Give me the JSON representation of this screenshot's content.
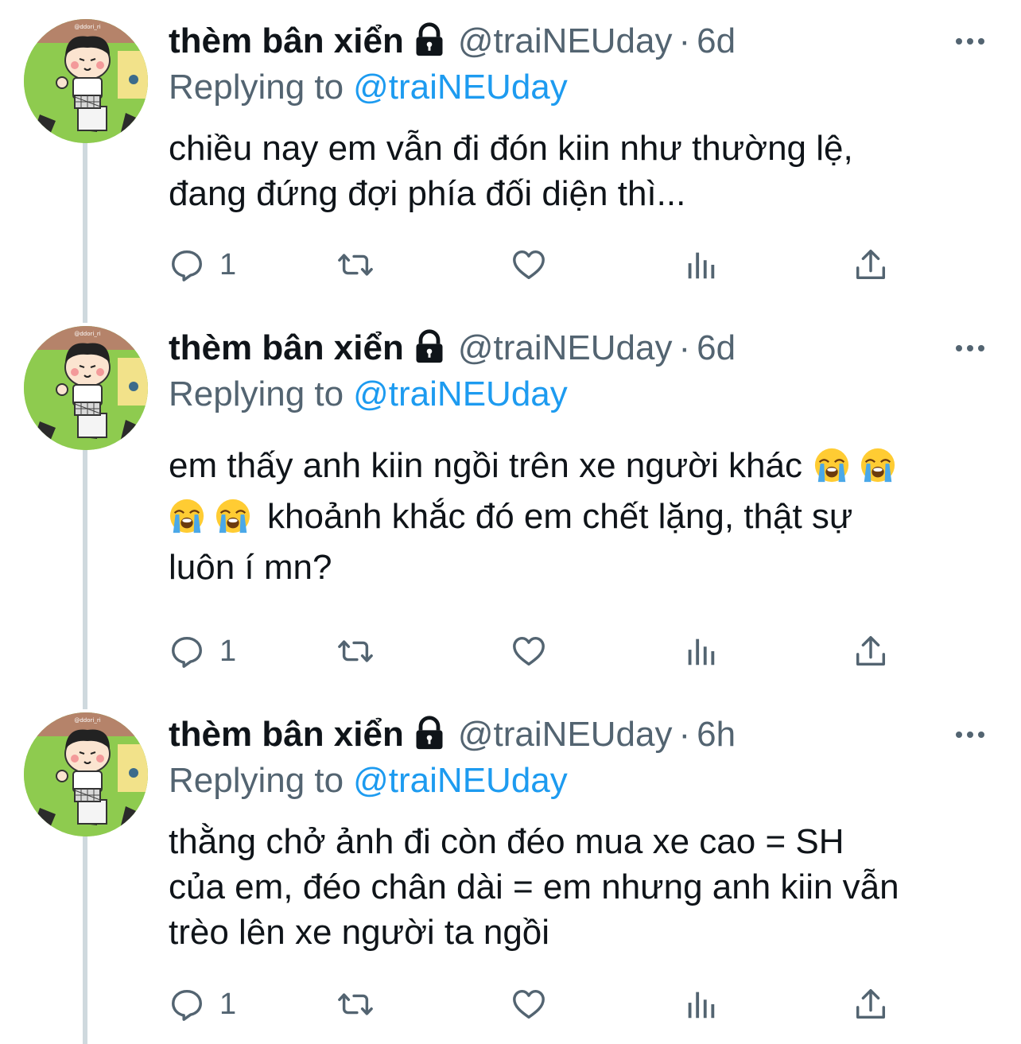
{
  "tweets": [
    {
      "display_name": "thèm bân xiển",
      "handle": "@traiNEUday",
      "dot": "·",
      "time": "6d",
      "replying_prefix": "Replying to",
      "replying_handle": "@traiNEUday",
      "lines": [
        "chiều nay em vẫn đi đón kiin như thường lệ,",
        "đang đứng đợi phía đối diện thì..."
      ],
      "reply_count": "1"
    },
    {
      "display_name": "thèm bân xiển",
      "handle": "@traiNEUday",
      "dot": "·",
      "time": "6d",
      "replying_prefix": "Replying to",
      "replying_handle": "@traiNEUday",
      "line1": "em thấy anh kiin ngồi trên xe người khác",
      "line2": "khoảnh khắc đó em chết lặng, thật sự",
      "line3": "luôn í mn?",
      "reply_count": "1"
    },
    {
      "display_name": "thèm bân xiển",
      "handle": "@traiNEUday",
      "dot": "·",
      "time": "6h",
      "replying_prefix": "Replying to",
      "replying_handle": "@traiNEUday",
      "lines": [
        "thằng chở ảnh đi còn đéo mua xe cao = SH",
        "của em, đéo chân dài = em nhưng anh kiin vẫn",
        "trèo lên xe người ta ngồi"
      ],
      "reply_count": "1"
    }
  ],
  "icons": {
    "lock": "lock-icon",
    "more": "more-icon",
    "reply": "reply-icon",
    "retweet": "retweet-icon",
    "like": "heart-icon",
    "views": "analytics-icon",
    "share": "share-icon",
    "emoji": "loudly-crying-face-emoji"
  },
  "colors": {
    "text": "#0f1419",
    "secondary": "#536471",
    "link": "#1d9bf0",
    "thread_line": "#cfd9de"
  }
}
